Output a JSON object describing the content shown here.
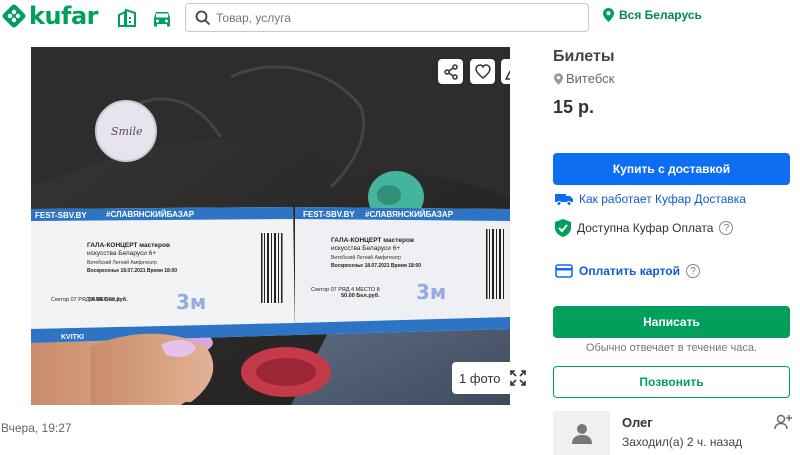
{
  "header": {
    "logo_text": "kufar",
    "search_placeholder": "Товар, услуга",
    "region": "Вся Беларусь",
    "brand_color": "#00a05a"
  },
  "icons": {
    "realty": "building-icon",
    "auto": "car-icon",
    "search": "search-icon",
    "region": "location-pin-icon",
    "share": "share-icon",
    "favorite": "heart-icon",
    "report": "warning-icon",
    "expand": "expand-icon",
    "delivery": "truck-icon",
    "pay": "shield-check-icon",
    "card": "card-icon",
    "follow": "add-user-icon"
  },
  "photo": {
    "count_label": "1 фото",
    "ticket_header_left": "FEST-SBV.BY",
    "ticket_header_right": "#СЛАВЯНСКИЙБАЗАР",
    "ticket_title": "ГАЛА-КОНЦЕРТ мастеров",
    "ticket_subtitle": "искусства Беларуси 6+",
    "ticket_venue": "Витебский Летний Амфитеатр",
    "ticket_date_left": "Воскресенье 18.07.2021  Время 18:00",
    "ticket_date_right": "Воскресенье 18.07.2021  Время 18:00",
    "ticket_seat_left": "Сектор 07\nРЯД 4\nМЕСТО 9",
    "ticket_seat_right": "Сектор 07\nРЯД 4\nМЕСТО 8",
    "ticket_price": "50.00 Бел.руб.",
    "ticket_brand": "KVITKI",
    "pin_text": "Smile"
  },
  "posted": "Вчера, 19:27",
  "listing": {
    "title": "Билеты",
    "city": "Витебск",
    "price": "15 р."
  },
  "actions": {
    "buy_delivery": "Купить с доставкой",
    "how_delivery": "Как работает Куфар Доставка",
    "pay_available": "Доступна Куфар Оплата",
    "pay_card": "Оплатить картой",
    "write": "Написать",
    "reply_note": "Обычно отвечает в течение часа.",
    "call": "Позвонить"
  },
  "seller": {
    "name": "Олег",
    "last_seen": "Заходил(а) 2 ч. назад"
  }
}
